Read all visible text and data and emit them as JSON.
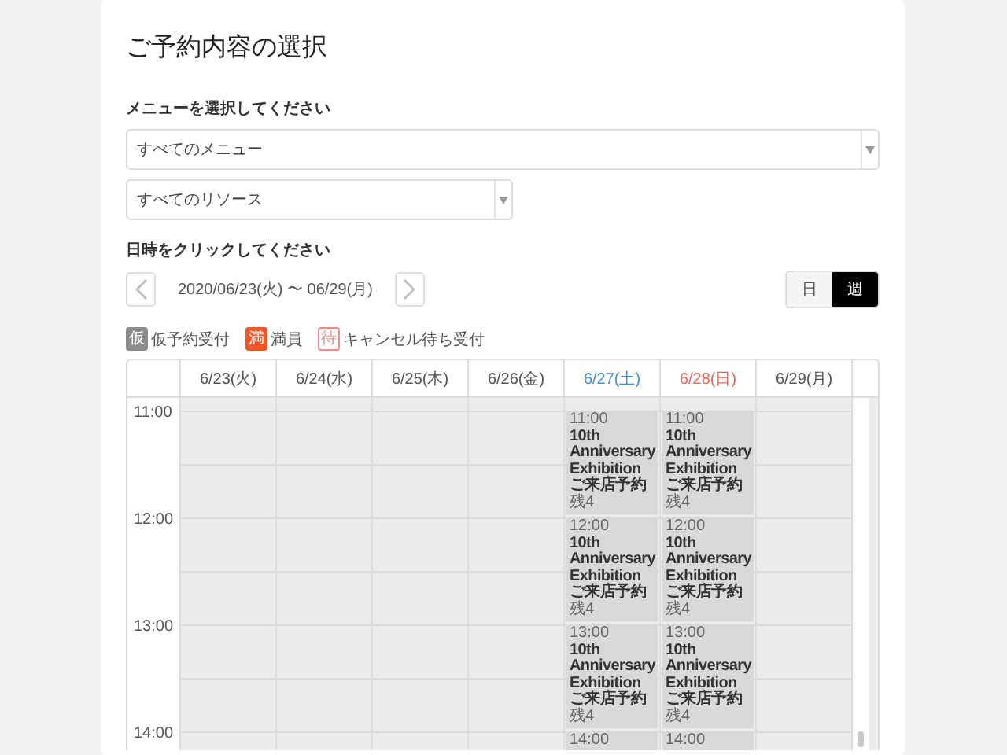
{
  "title": "ご予約内容の選択",
  "menu_label": "メニューを選択してください",
  "menu_select": {
    "value": "すべてのメニュー"
  },
  "resource_select": {
    "value": "すべてのリソース"
  },
  "date_label": "日時をクリックしてください",
  "date_range": "2020/06/23(火) 〜 06/29(月)",
  "view_toggle": [
    {
      "label": "日",
      "selected": false
    },
    {
      "label": "週",
      "selected": true
    }
  ],
  "legend": [
    {
      "badge": "仮",
      "label": "仮予約受付",
      "kind": "filled",
      "color": "#8c8c8c"
    },
    {
      "badge": "満",
      "label": "満員",
      "kind": "filled",
      "color": "#f0562a"
    },
    {
      "badge": "待",
      "label": "キャンセル待ち受付",
      "kind": "outlined",
      "color": "#f08c8c"
    }
  ],
  "times": [
    "11:00",
    "12:00",
    "13:00",
    "14:00"
  ],
  "days": [
    {
      "label": "6/23(火)",
      "kind": "weekday"
    },
    {
      "label": "6/24(水)",
      "kind": "weekday"
    },
    {
      "label": "6/25(木)",
      "kind": "weekday"
    },
    {
      "label": "6/26(金)",
      "kind": "weekday"
    },
    {
      "label": "6/27(土)",
      "kind": "saturday",
      "events": [
        {
          "time": "11:00",
          "title": "10th Anniversary Exhibition ご来店予約",
          "remaining": "残4"
        },
        {
          "time": "12:00",
          "title": "10th Anniversary Exhibition ご来店予約",
          "remaining": "残4"
        },
        {
          "time": "13:00",
          "title": "10th Anniversary Exhibition ご来店予約",
          "remaining": "残4"
        },
        {
          "time": "14:00"
        }
      ]
    },
    {
      "label": "6/28(日)",
      "kind": "sunday",
      "events": [
        {
          "time": "11:00",
          "title": "10th Anniversary Exhibition ご来店予約",
          "remaining": "残4"
        },
        {
          "time": "12:00",
          "title": "10th Anniversary Exhibition ご来店予約",
          "remaining": "残4"
        },
        {
          "time": "13:00",
          "title": "10th Anniversary Exhibition ご来店予約",
          "remaining": "残4"
        },
        {
          "time": "14:00"
        }
      ]
    },
    {
      "label": "6/29(月)",
      "kind": "weekday"
    }
  ]
}
